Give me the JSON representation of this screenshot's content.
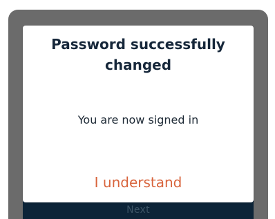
{
  "background": {
    "next_button_label": "Next"
  },
  "dialog": {
    "title": "Password successfully changed",
    "message": "You are now signed in",
    "confirm_label": "I understand"
  },
  "colors": {
    "accent": "#d8643c",
    "title": "#16273a",
    "footer": "#0c2438"
  }
}
